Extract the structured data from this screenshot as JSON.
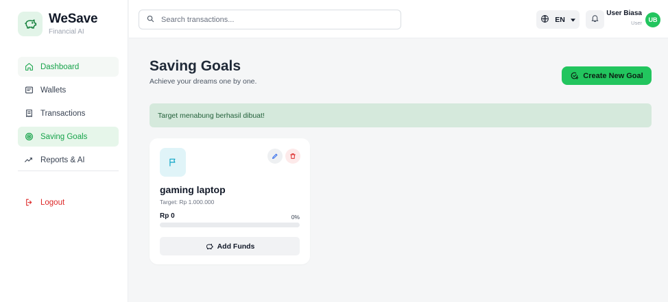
{
  "brand": {
    "name": "WeSave",
    "subtitle": "Financial AI"
  },
  "sidebar": {
    "items": [
      {
        "label": "Dashboard",
        "icon": "home-icon"
      },
      {
        "label": "Wallets",
        "icon": "wallet-icon"
      },
      {
        "label": "Transactions",
        "icon": "receipt-icon"
      },
      {
        "label": "Saving Goals",
        "icon": "target-icon",
        "active": true
      },
      {
        "label": "Reports & AI",
        "icon": "trend-icon"
      }
    ],
    "logout": "Logout"
  },
  "header": {
    "search_placeholder": "Search transactions...",
    "language": "EN",
    "user_name": "User Biasa",
    "user_role": "User",
    "avatar_initials": "UB"
  },
  "main": {
    "title": "Saving Goals",
    "subtitle": "Achieve your dreams one by one.",
    "create_button": "Create New Goal",
    "alert": "Target menabung berhasil dibuat!"
  },
  "goals": [
    {
      "name": "gaming laptop",
      "target": "Target: Rp 1.000.000",
      "amount": "Rp 0",
      "percent": "0%",
      "progress": 0,
      "add_funds_label": "Add Funds"
    }
  ],
  "colors": {
    "accent": "#22c55e",
    "alert_bg": "#d5e9dc",
    "alert_text": "#23603a",
    "danger": "#dc2626"
  }
}
